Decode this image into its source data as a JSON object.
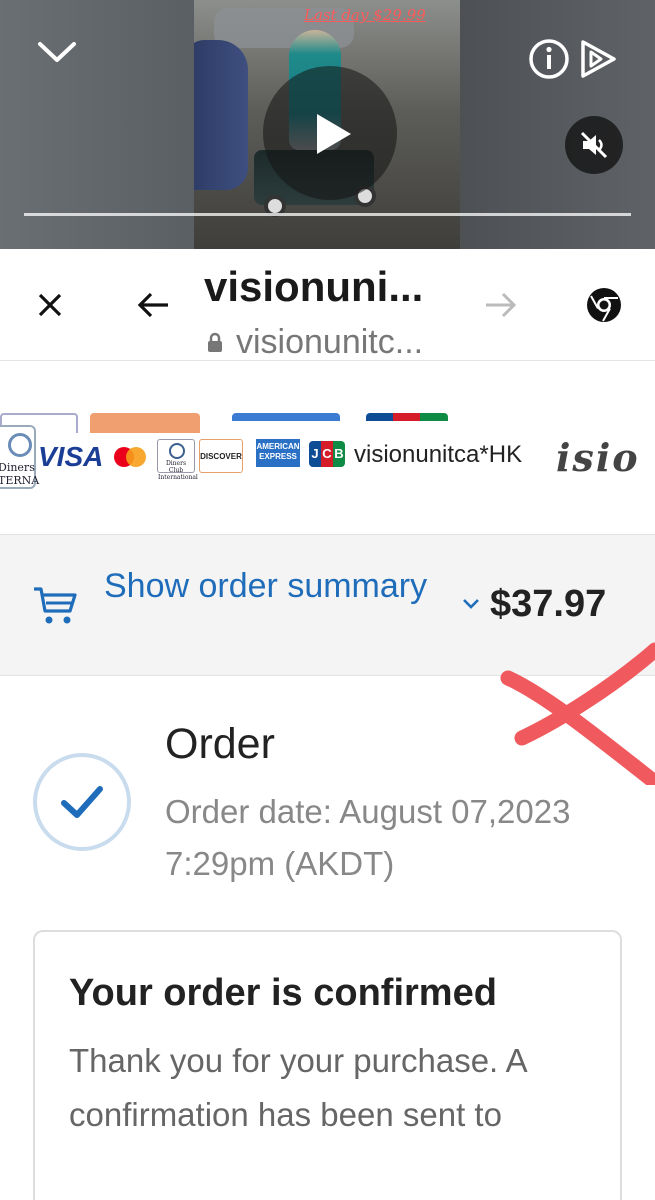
{
  "video": {
    "promo_text": "Last day $29.99",
    "progress": 0.0
  },
  "browser": {
    "title": "visionuni...",
    "url": "visionunitc..."
  },
  "payment": {
    "cards": [
      "VISA",
      "Diners Club International",
      "DISCOVER",
      "AMERICAN EXPRESS",
      "JCB"
    ],
    "partial_card_label": "Diners",
    "partial_card_label_2": "TERNA",
    "merchant_descriptor": "visionunitca*HK",
    "brand_overflow": "isio"
  },
  "order_summary": {
    "link_label": "Show order summary",
    "total": "$37.97"
  },
  "order": {
    "title": "Order",
    "date_text": "Order date:  August 07,2023 7:29pm (AKDT)"
  },
  "confirmation": {
    "title": "Your order is confirmed",
    "body": "Thank you for your purchase. A confirmation has been sent to"
  },
  "colors": {
    "link": "#1f6dba",
    "annotation_x": "#f05a5f",
    "check": "#1f6dba"
  }
}
